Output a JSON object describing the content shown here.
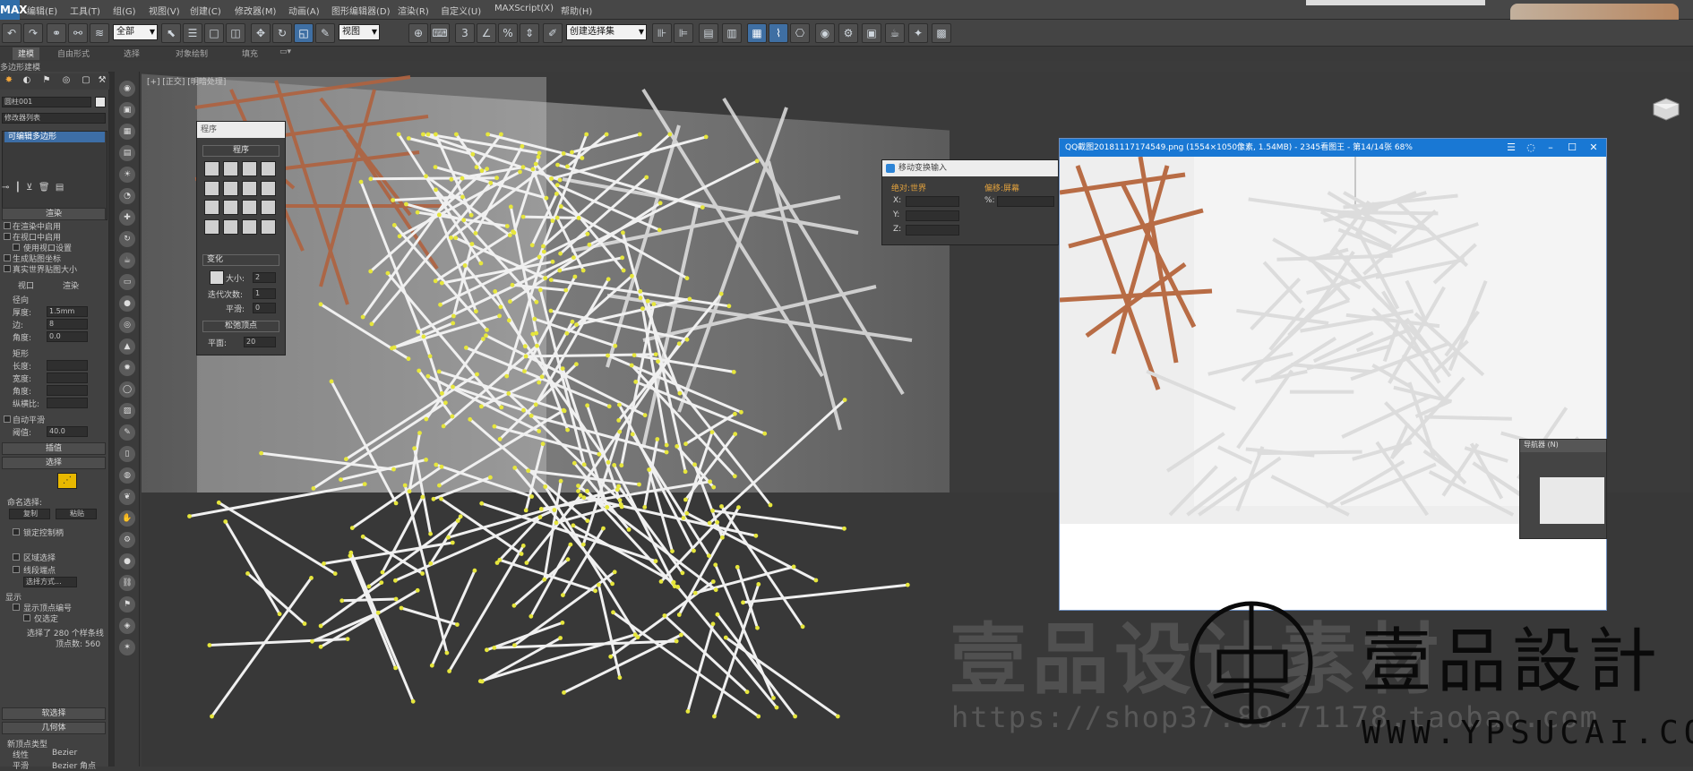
{
  "app": {
    "logo_text": "MAX"
  },
  "menubar": {
    "items": [
      "编辑(E)",
      "工具(T)",
      "组(G)",
      "视图(V)",
      "创建(C)",
      "修改器(M)",
      "动画(A)",
      "图形编辑器(D)",
      "渲染(R)",
      "自定义(U)",
      "MAXScript(X)",
      "帮助(H)"
    ]
  },
  "toolbar": {
    "selection_filter": "全部",
    "ref_coord": "视图",
    "named_selection": "创建选择集"
  },
  "ribbon": {
    "tabs": [
      "建模",
      "自由形式",
      "选择",
      "对象绘制",
      "填充"
    ],
    "active_tab": "建模",
    "subtitle": "多边形建模"
  },
  "command_panel": {
    "object_name": "圆柱001",
    "modifier_list_label": "修改器列表",
    "stack_item": "可编辑多边形",
    "rollouts": {
      "render": "渲染",
      "enable_render": "在渲染中启用",
      "enable_viewport": "在视口中启用",
      "use_viewport_settings": "使用视口设置",
      "generate_mapping": "生成贴图坐标",
      "real_world": "真实世界贴图大小",
      "viewport": "视口",
      "renderer": "渲染",
      "radial": "径向",
      "thickness_label": "厚度:",
      "thickness_value": "1.5mm",
      "sides_label": "边:",
      "sides_value": "8",
      "angle_label": "角度:",
      "angle_value": "0.0",
      "rectangular": "矩形",
      "length_label": "长度:",
      "width_label": "宽度:",
      "angle2_label": "角度:",
      "aspect_label": "纵横比:",
      "auto_smooth": "自动平滑",
      "threshold_label": "阈值:",
      "threshold_value": "40.0",
      "interpolation": "插值",
      "selection": "选择",
      "named_selection": "命名选择:",
      "copy": "复制",
      "paste": "粘贴",
      "lock_handles": "锁定控制柄",
      "area_selection": "区域选择",
      "segment_end": "线段端点",
      "select_by": "选择方式...",
      "display": "显示",
      "show_vertex_numbers": "显示顶点编号",
      "only_selected": "仅选定",
      "selected_count": "选择了 280 个样条线",
      "vertex_count": "顶点数: 560",
      "soft_selection": "软选择",
      "geometry": "几何体",
      "new_vertex_type": "新顶点类型",
      "linear": "线性",
      "bezier": "Bezier",
      "smooth": "平滑",
      "bezier_corner": "Bezier 角点"
    }
  },
  "viewport": {
    "label": "[+] [正交] [明暗处理]"
  },
  "modeler_panel": {
    "title": "程序",
    "section": "程序",
    "deform_header": "变化",
    "size_label": "大小:",
    "size_value": "2",
    "iterations_label": "迭代次数:",
    "iterations_value": "1",
    "smooth_label": "平滑:",
    "smooth_value": "0",
    "relax_header": "松弛顶点",
    "relax_label": "平面:",
    "relax_value": "20"
  },
  "numeric_dialog": {
    "title": "移动变换输入",
    "absolute_header": "绝对:世界",
    "offset_header": "偏移:屏幕",
    "axes": [
      "X:",
      "Y:",
      "Z:"
    ],
    "offset_axis": "%:"
  },
  "image_viewer": {
    "title": "QQ截图20181117174549.png  (1554×1050像素, 1.54MB) - 2345看图王 - 第14/14张 68%"
  },
  "navigator": {
    "title": "导航器 (N)"
  },
  "watermark": {
    "big_text": "壹品设计素材",
    "url_text": "https://shop37.89.71178.taobao.com"
  },
  "brand": {
    "name": "壹品設計",
    "url": "WWW.YPSUCAI.COM"
  }
}
